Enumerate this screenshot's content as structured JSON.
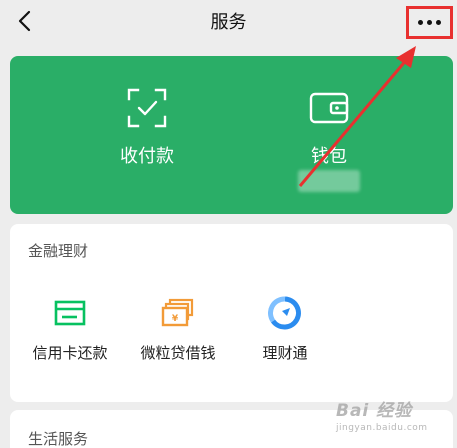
{
  "header": {
    "title": "服务"
  },
  "wallet_card": {
    "items": [
      {
        "label": "收付款",
        "icon": "scan-pay-icon"
      },
      {
        "label": "钱包",
        "icon": "wallet-icon"
      }
    ]
  },
  "finance": {
    "title": "金融理财",
    "items": [
      {
        "label": "信用卡还款",
        "icon": "credit-card-icon",
        "color": "#07c160"
      },
      {
        "label": "微粒贷借钱",
        "icon": "cash-bills-icon",
        "color": "#f29b38"
      },
      {
        "label": "理财通",
        "icon": "licaitong-icon",
        "color": "#2b8cef"
      }
    ]
  },
  "life": {
    "title": "生活服务"
  },
  "colors": {
    "accent_green": "#2aae67",
    "highlight_red": "#e8302f"
  },
  "watermark": {
    "top": "Bai 经验",
    "bottom": "jingyan.baidu.com"
  }
}
